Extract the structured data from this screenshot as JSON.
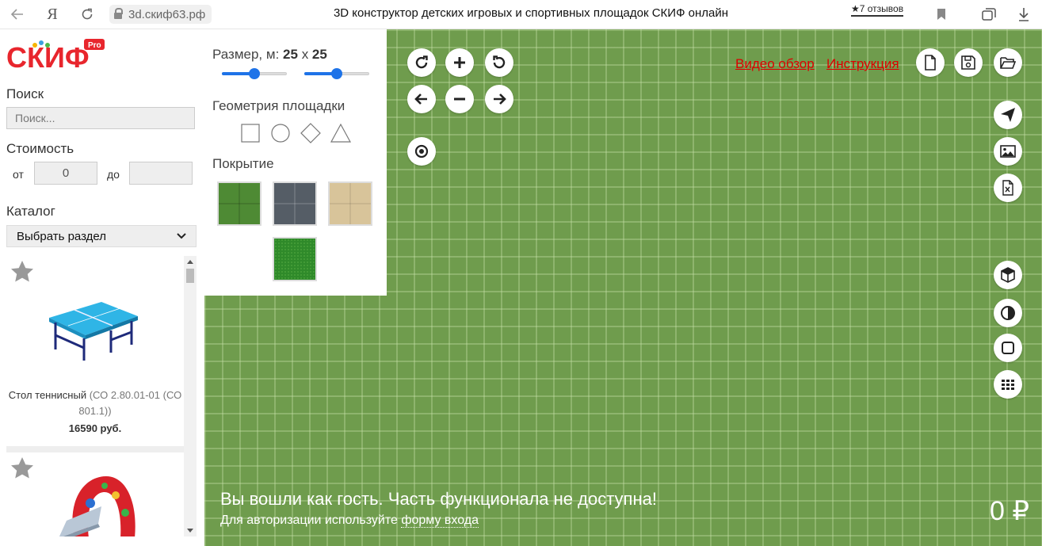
{
  "browser": {
    "address": "3d.скиф63.рф",
    "title": "3D конструктор детских игровых и спортивных площадок СКИФ онлайн",
    "reviews": "★7 отзывов",
    "yandex_glyph": "Я"
  },
  "sidebar": {
    "logo_text": "СКИФ",
    "logo_badge": "Pro",
    "search": {
      "label": "Поиск",
      "placeholder": "Поиск..."
    },
    "cost": {
      "label": "Стоимость",
      "from_label": "от",
      "from_value": "0",
      "to_label": "до",
      "to_value": ""
    },
    "catalog": {
      "label": "Каталог",
      "selected": "Выбрать раздел"
    },
    "products": [
      {
        "name": "Стол теннисный",
        "code": "(СО 2.80.01-01 (СО 801.1))",
        "price": "16590 руб."
      },
      {
        "name": "",
        "code": "",
        "price": ""
      }
    ]
  },
  "config": {
    "size_label": "Размер, м:",
    "size_x": "25",
    "size_sep": "x",
    "size_y": "25",
    "slider_x_fraction": 0.5,
    "slider_y_fraction": 0.5,
    "geometry_label": "Геометрия площадки",
    "shapes": [
      "square",
      "circle",
      "diamond",
      "triangle"
    ],
    "cover_label": "Покрытие",
    "covers": [
      {
        "name": "grass-tiles",
        "color": "#4e8a34"
      },
      {
        "name": "rubber-gray",
        "color": "#555d66"
      },
      {
        "name": "sand",
        "color": "#d8c49a"
      },
      {
        "name": "lawn",
        "color": "#2f8a2a"
      }
    ]
  },
  "scene": {
    "links": {
      "video": "Видео обзор",
      "manual": "Инструкция"
    },
    "guest_message": "Вы вошли как гость. Часть функционала не доступна!",
    "auth_text": "Для авторизации используйте",
    "auth_link": "форму входа",
    "total": "0 ₽"
  }
}
